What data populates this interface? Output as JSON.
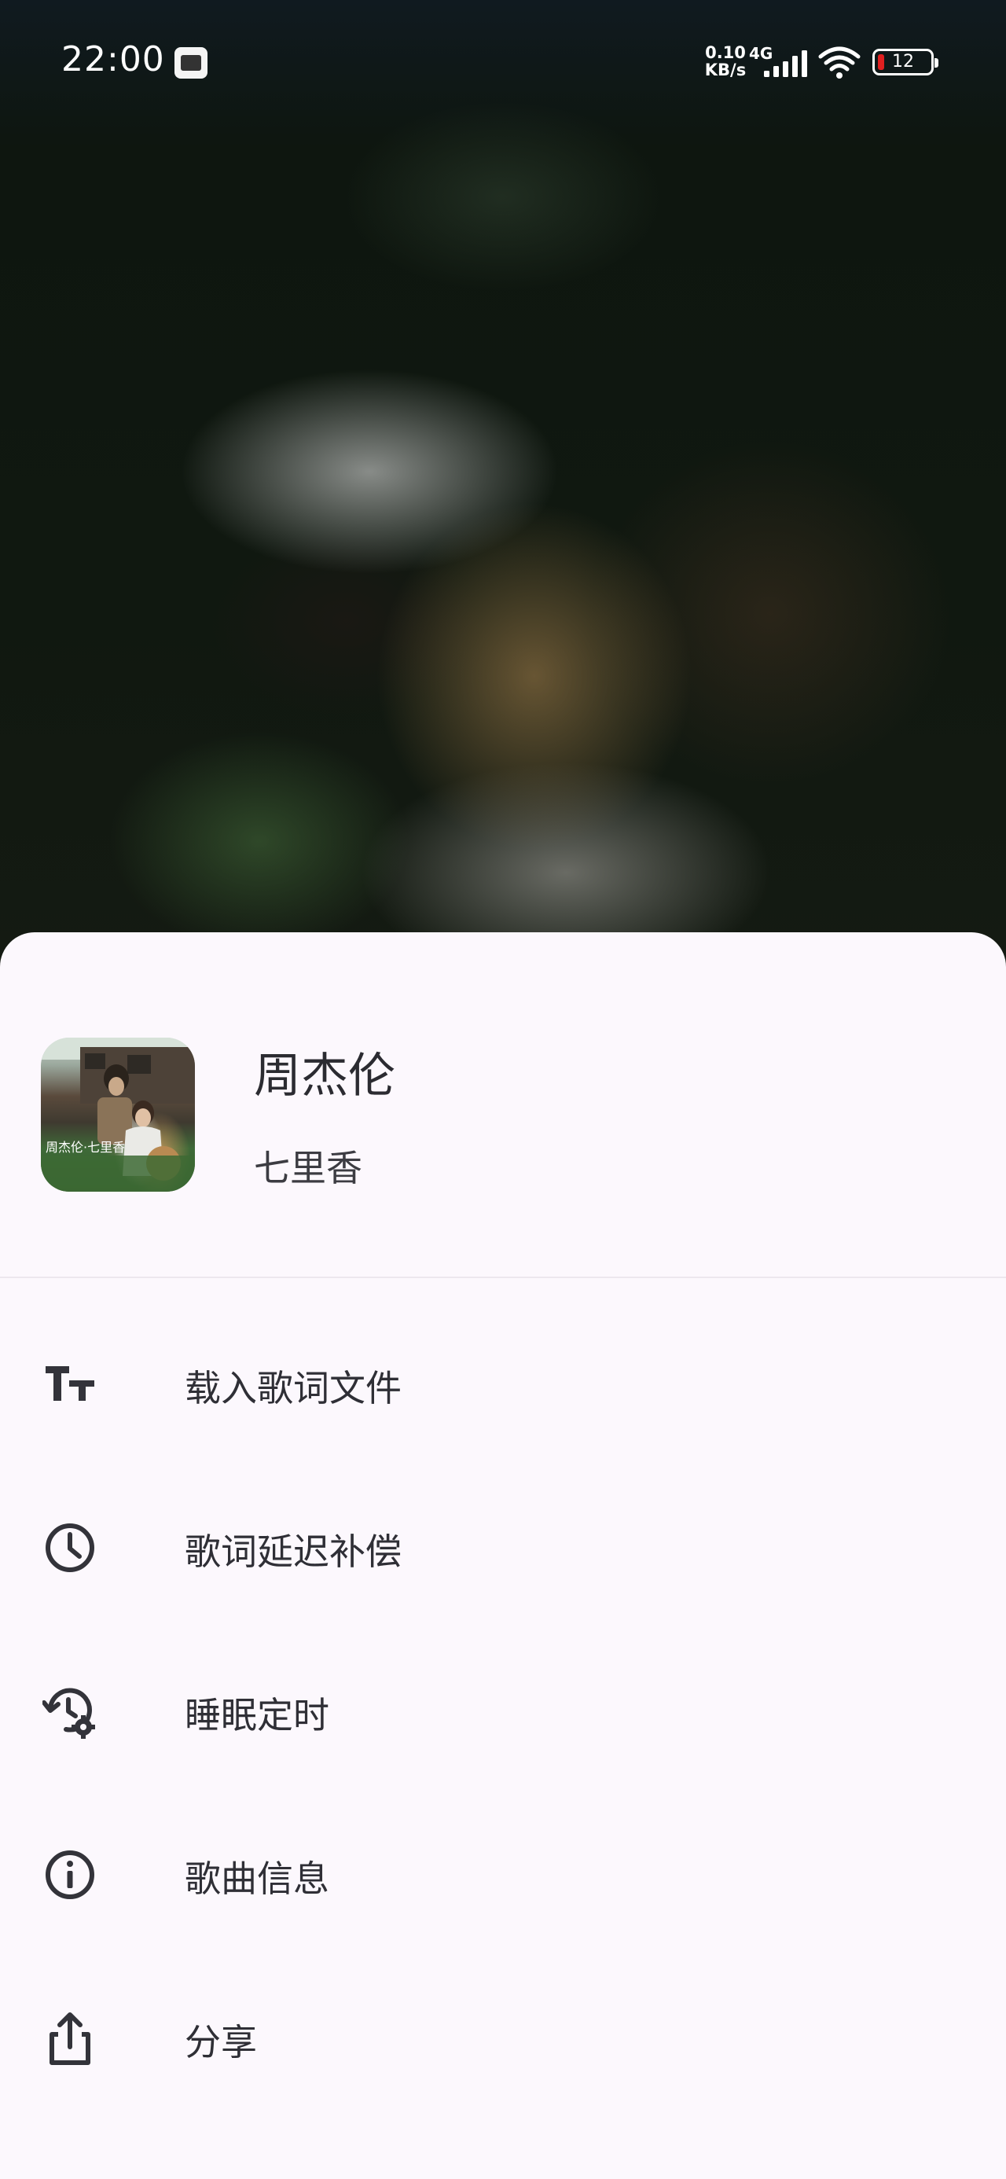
{
  "status_bar": {
    "time": "22:00",
    "net_speed_value": "0.10",
    "net_speed_unit": "KB/s",
    "network_type": "4G",
    "battery_level": "12",
    "icons": [
      "mt-manager-icon",
      "cell-signal-icon",
      "wifi-icon",
      "battery-icon"
    ],
    "battery_color": "#e02020"
  },
  "sheet": {
    "artist": "周杰伦",
    "song": "七里香",
    "album_art_text": "周杰伦·七里香",
    "menu": [
      {
        "label": "载入歌词文件",
        "icon": "text-size-icon"
      },
      {
        "label": "歌词延迟补偿",
        "icon": "clock-icon"
      },
      {
        "label": "睡眠定时",
        "icon": "history-settings-icon"
      },
      {
        "label": "歌曲信息",
        "icon": "info-icon"
      },
      {
        "label": "分享",
        "icon": "share-icon"
      }
    ]
  },
  "colors": {
    "sheet_background": "#fcf8fd",
    "text_primary": "#2b2b31",
    "icon": "#33333a"
  }
}
